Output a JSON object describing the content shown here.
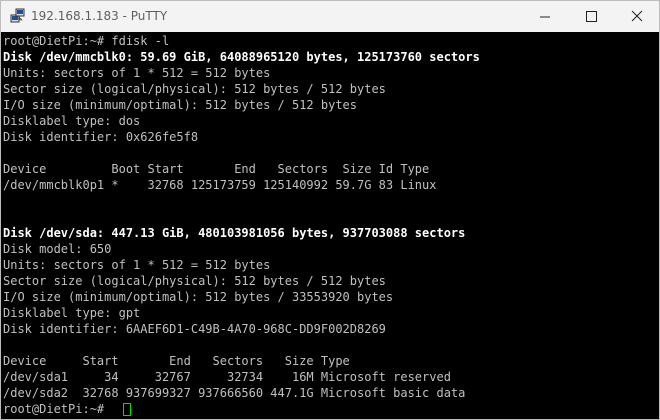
{
  "window": {
    "title": "192.168.1.183 - PuTTY",
    "app_icon": "putty-icon",
    "controls": [
      "minimize-icon",
      "maximize-icon",
      "close-icon"
    ]
  },
  "terminal": {
    "colors": {
      "background": "#000000",
      "text": "#c0c0c0",
      "bold_text": "#ffffff",
      "cursor": "#00e000"
    },
    "lines": [
      "root@DietPi:~# fdisk -l",
      "Disk /dev/mmcblk0: 59.69 GiB, 64088965120 bytes, 125173760 sectors",
      "Units: sectors of 1 * 512 = 512 bytes",
      "Sector size (logical/physical): 512 bytes / 512 bytes",
      "I/O size (minimum/optimal): 512 bytes / 512 bytes",
      "Disklabel type: dos",
      "Disk identifier: 0x626fe5f8",
      "",
      "Device         Boot Start       End   Sectors  Size Id Type",
      "/dev/mmcblk0p1 *    32768 125173759 125140992 59.7G 83 Linux",
      "",
      "",
      "Disk /dev/sda: 447.13 GiB, 480103981056 bytes, 937703088 sectors",
      "Disk model: 650",
      "Units: sectors of 1 * 512 = 512 bytes",
      "Sector size (logical/physical): 512 bytes / 512 bytes",
      "I/O size (minimum/optimal): 512 bytes / 33553920 bytes",
      "Disklabel type: gpt",
      "Disk identifier: 6AAEF6D1-C49B-4A70-968C-DD9F002D8269",
      "",
      "Device     Start       End   Sectors   Size Type",
      "/dev/sda1     34     32767     32734    16M Microsoft reserved",
      "/dev/sda2  32768 937699327 937666560 447.1G Microsoft basic data",
      "root@DietPi:~# "
    ]
  }
}
